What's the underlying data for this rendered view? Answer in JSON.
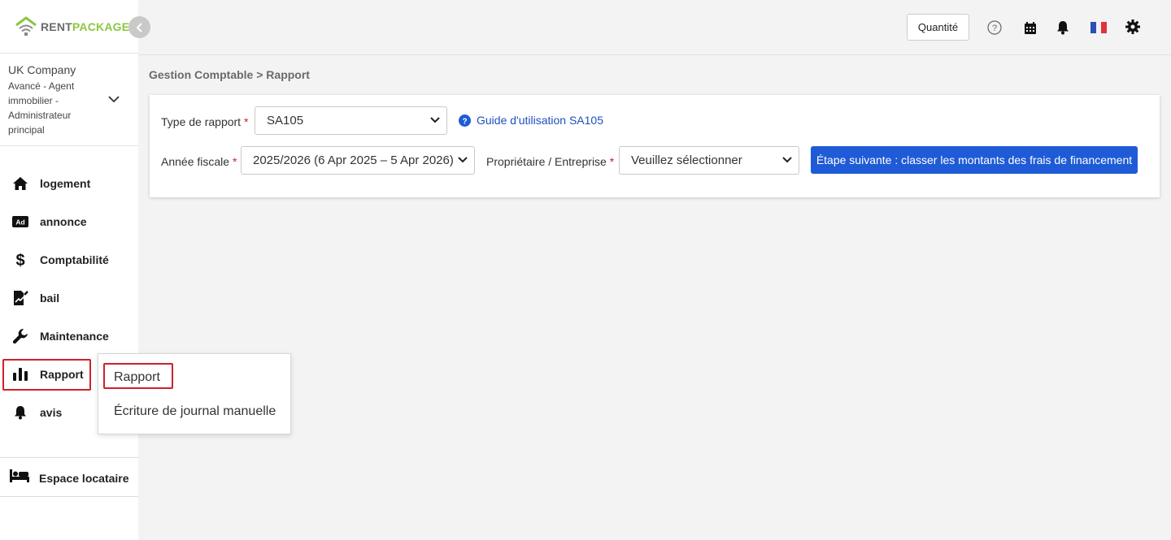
{
  "brand": {
    "rent": "RENT",
    "package": "PACKAGE",
    "accent": "#8cc63f"
  },
  "company": {
    "name": "UK Company",
    "role": "Avancé - Agent immobilier - Administrateur principal"
  },
  "nav": {
    "items": [
      {
        "label": "logement",
        "icon": "house-icon"
      },
      {
        "label": "annonce",
        "icon": "ad-icon"
      },
      {
        "label": "Comptabilité",
        "icon": "dollar-icon"
      },
      {
        "label": "bail",
        "icon": "contract-icon"
      },
      {
        "label": "Maintenance",
        "icon": "wrench-icon"
      },
      {
        "label": "Rapport",
        "icon": "bar-chart-icon"
      },
      {
        "label": "avis",
        "icon": "bell-icon"
      }
    ],
    "tenant": {
      "label": "Espace locataire",
      "icon": "bed-icon"
    }
  },
  "header": {
    "quantity_label": "Quantité",
    "icons": [
      "help-icon",
      "calendar-icon",
      "notification-bell-icon",
      "french-flag-icon",
      "settings-gear-icon"
    ]
  },
  "breadcrumb": "Gestion Comptable > Rapport",
  "form": {
    "report_type_label": "Type de rapport",
    "report_type_value": "SA105",
    "guide_link": "Guide d'utilisation SA105",
    "fiscal_year_label": "Année fiscale",
    "fiscal_year_value": "2025/2026 (6 Apr 2025 – 5 Apr 2026)",
    "owner_label": "Propriétaire / Entreprise",
    "owner_placeholder": "Veuillez sélectionner",
    "required_mark": "*",
    "next_button": "Étape suivante : classer les montants des frais de financement"
  },
  "submenu": {
    "items": [
      "Rapport",
      "Écriture de journal manuelle"
    ]
  },
  "colors": {
    "primary": "#1f5bd6",
    "highlight": "#d0202a",
    "link": "#1f4fbf"
  }
}
